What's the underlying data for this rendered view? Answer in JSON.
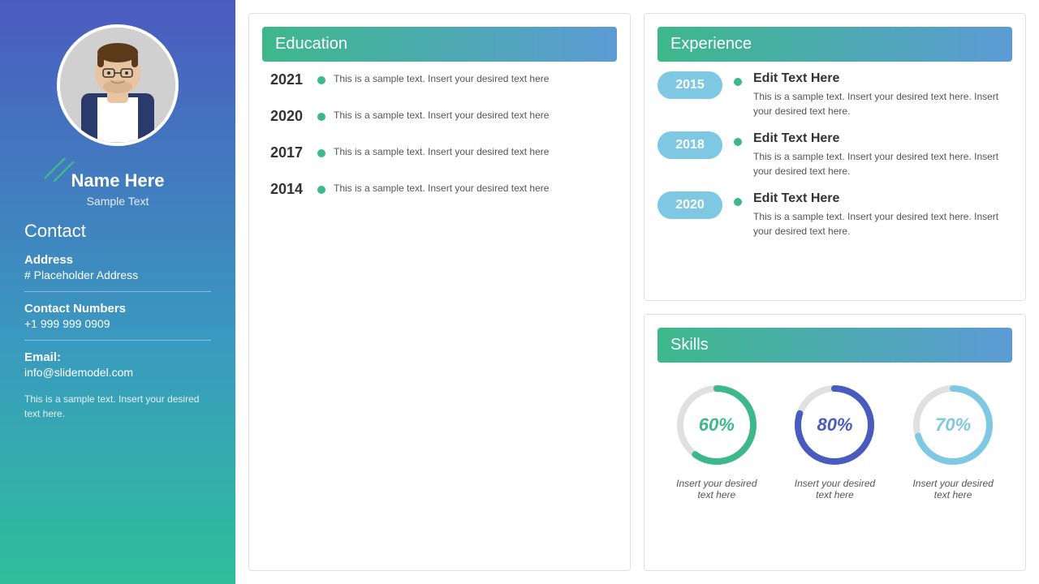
{
  "sidebar": {
    "name": "Name Here",
    "subtitle": "Sample Text",
    "contact_title": "Contact",
    "address_label": "Address",
    "address_value": "# Placeholder Address",
    "contact_label": "Contact Numbers",
    "contact_value": "+1 999 999 0909",
    "email_label": "Email:",
    "email_value": "info@slidemodel.com",
    "footer_text": "This is a sample text. Insert your desired text here."
  },
  "education": {
    "title": "Education",
    "items": [
      {
        "year": "2021",
        "text": "This is a sample text. Insert your desired text here"
      },
      {
        "year": "2020",
        "text": "This is a sample text. Insert your desired text here"
      },
      {
        "year": "2017",
        "text": "This is a sample text. Insert your desired text here"
      },
      {
        "year": "2014",
        "text": "This is a sample text. Insert your desired text here"
      }
    ]
  },
  "experience": {
    "title": "Experience",
    "items": [
      {
        "year": "2015",
        "title": "Edit Text Here",
        "description": "This is a sample text. Insert your desired text here. Insert your desired text here."
      },
      {
        "year": "2018",
        "title": "Edit Text Here",
        "description": "This is a sample text. Insert your desired text here. Insert your desired text here."
      },
      {
        "year": "2020",
        "title": "Edit Text Here",
        "description": "This is a sample text. Insert your desired text here. Insert your desired text here."
      }
    ]
  },
  "skills": {
    "title": "Skills",
    "items": [
      {
        "percentage": 60,
        "label": "Insert your desired\ntext here",
        "color": "#3DB88A",
        "track_color": "#e0e0e0"
      },
      {
        "percentage": 80,
        "label": "Insert your desired\ntext here",
        "color": "#4A5BBF",
        "track_color": "#e0e0e0"
      },
      {
        "percentage": 70,
        "label": "Insert your desired\ntext here",
        "color": "#7EC8E3",
        "track_color": "#e0e0e0"
      }
    ]
  }
}
